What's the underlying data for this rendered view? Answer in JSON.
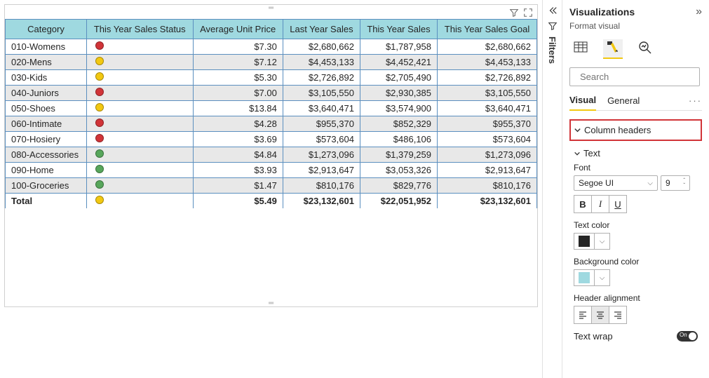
{
  "table": {
    "columns": [
      "Category",
      "This Year Sales Status",
      "Average Unit Price",
      "Last Year Sales",
      "This Year Sales",
      "This Year Sales Goal"
    ],
    "rows": [
      {
        "category": "010-Womens",
        "status": "#d13438",
        "avgPrice": "$7.30",
        "lastYear": "$2,680,662",
        "thisYear": "$1,787,958",
        "goal": "$2,680,662"
      },
      {
        "category": "020-Mens",
        "status": "#f2c811",
        "avgPrice": "$7.12",
        "lastYear": "$4,453,133",
        "thisYear": "$4,452,421",
        "goal": "$4,453,133"
      },
      {
        "category": "030-Kids",
        "status": "#f2c811",
        "avgPrice": "$5.30",
        "lastYear": "$2,726,892",
        "thisYear": "$2,705,490",
        "goal": "$2,726,892"
      },
      {
        "category": "040-Juniors",
        "status": "#d13438",
        "avgPrice": "$7.00",
        "lastYear": "$3,105,550",
        "thisYear": "$2,930,385",
        "goal": "$3,105,550"
      },
      {
        "category": "050-Shoes",
        "status": "#f2c811",
        "avgPrice": "$13.84",
        "lastYear": "$3,640,471",
        "thisYear": "$3,574,900",
        "goal": "$3,640,471"
      },
      {
        "category": "060-Intimate",
        "status": "#d13438",
        "avgPrice": "$4.28",
        "lastYear": "$955,370",
        "thisYear": "$852,329",
        "goal": "$955,370"
      },
      {
        "category": "070-Hosiery",
        "status": "#d13438",
        "avgPrice": "$3.69",
        "lastYear": "$573,604",
        "thisYear": "$486,106",
        "goal": "$573,604"
      },
      {
        "category": "080-Accessories",
        "status": "#57a65b",
        "avgPrice": "$4.84",
        "lastYear": "$1,273,096",
        "thisYear": "$1,379,259",
        "goal": "$1,273,096"
      },
      {
        "category": "090-Home",
        "status": "#57a65b",
        "avgPrice": "$3.93",
        "lastYear": "$2,913,647",
        "thisYear": "$3,053,326",
        "goal": "$2,913,647"
      },
      {
        "category": "100-Groceries",
        "status": "#57a65b",
        "avgPrice": "$1.47",
        "lastYear": "$810,176",
        "thisYear": "$829,776",
        "goal": "$810,176"
      }
    ],
    "total": {
      "label": "Total",
      "status": "#f2c811",
      "avgPrice": "$5.49",
      "lastYear": "$23,132,601",
      "thisYear": "$22,051,952",
      "goal": "$23,132,601"
    }
  },
  "sideTab": {
    "label": "Filters"
  },
  "viz": {
    "title": "Visualizations",
    "subtitle": "Format visual",
    "searchPlaceholder": "Search",
    "tabs": {
      "visual": "Visual",
      "general": "General"
    },
    "accordion": "Column headers",
    "textSection": "Text",
    "fontLabel": "Font",
    "fontName": "Segoe UI",
    "fontSize": "9",
    "bold": "B",
    "italic": "I",
    "underline": "U",
    "textColorLabel": "Text color",
    "textColor": "#252525",
    "bgColorLabel": "Background color",
    "bgColor": "#9fd9e0",
    "alignLabel": "Header alignment",
    "wrapLabel": "Text wrap",
    "wrapState": "On"
  }
}
